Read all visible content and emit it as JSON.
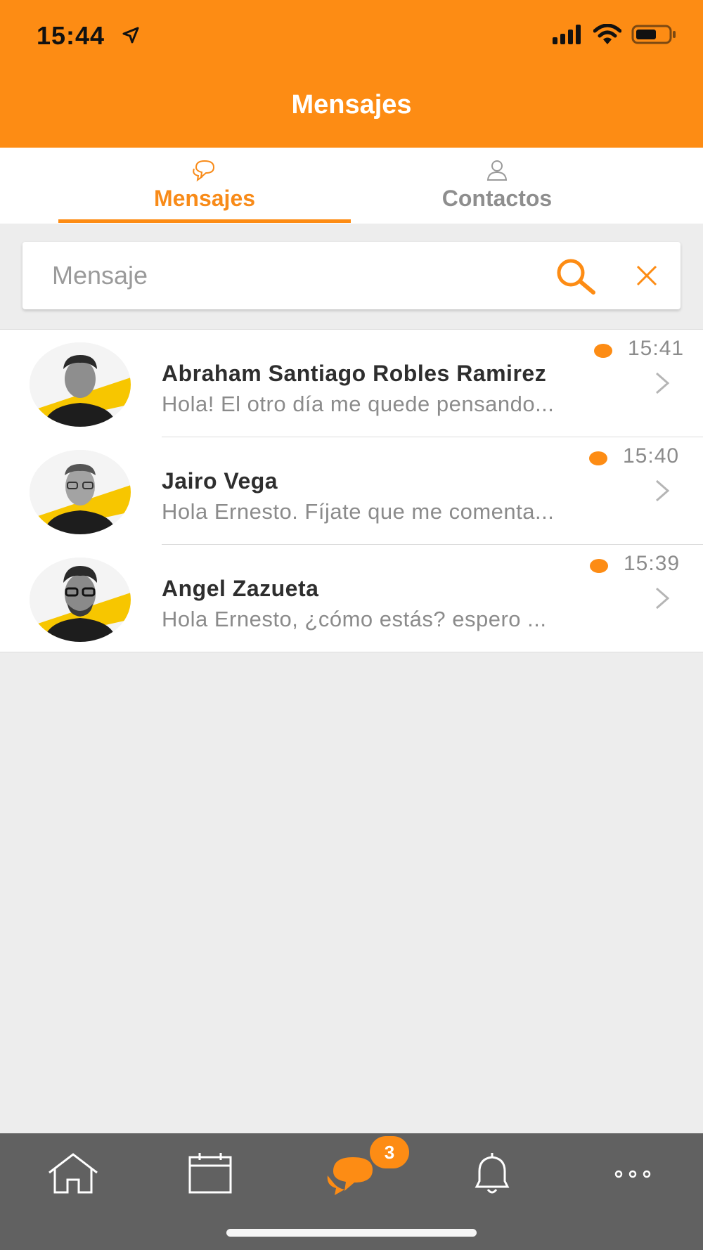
{
  "status_bar": {
    "time": "15:44"
  },
  "header": {
    "title": "Mensajes"
  },
  "tabs": [
    {
      "label": "Mensajes",
      "icon": "chat-bubbles-icon",
      "active": true
    },
    {
      "label": "Contactos",
      "icon": "person-icon",
      "active": false
    }
  ],
  "search": {
    "placeholder": "Mensaje",
    "value": ""
  },
  "conversations": [
    {
      "name": "Abraham Santiago Robles Ramirez",
      "preview": "Hola! El otro día me quede pensando...",
      "time": "15:41",
      "unread": true
    },
    {
      "name": "Jairo Vega",
      "preview": "Hola Ernesto. Fíjate que me comenta...",
      "time": "15:40",
      "unread": true
    },
    {
      "name": "Angel Zazueta",
      "preview": "Hola Ernesto, ¿cómo estás? espero ...",
      "time": "15:39",
      "unread": true
    }
  ],
  "tab_bar": {
    "items": [
      {
        "icon": "home-icon"
      },
      {
        "icon": "calendar-icon"
      },
      {
        "icon": "chat-icon",
        "active": true
      },
      {
        "icon": "bell-icon"
      },
      {
        "icon": "more-icon"
      }
    ],
    "messages_badge": "3"
  },
  "colors": {
    "accent": "#fd8c14",
    "tabbar": "#616161",
    "background": "#ededed"
  }
}
